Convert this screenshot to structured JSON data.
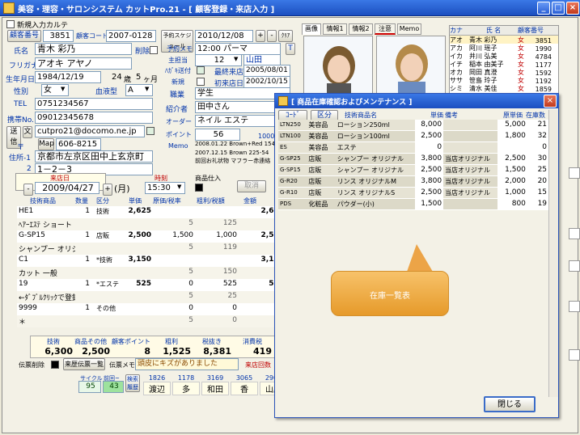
{
  "window": {
    "title": "美容・理容・サロンシステム カットPro.21 - [ 顧客登録・来店入力 ]"
  },
  "top": {
    "new_customer": "新規入力カルテ"
  },
  "customer": {
    "no_label": "顧客番号",
    "no": "3851",
    "code_label": "顧客コード",
    "code": "2007-0128",
    "delete_label": "削除",
    "name_label": "氏名",
    "name": "青木 彩乃",
    "kana_label": "フリガナ",
    "kana": "アオキ アヤノ",
    "birth_label": "生年月日",
    "birth": "1984/12/19",
    "age": "24",
    "age_unit": "歳",
    "month": "5",
    "month_unit": "ヶ月",
    "sex_label": "性別",
    "sex": "女",
    "blood_label": "血液型",
    "blood": "A",
    "tel_label": "TEL",
    "tel": "0751234567",
    "mobile_label": "携帯No.",
    "mobile": "09012345678",
    "mail_btn": "送信",
    "mail_sub": "文",
    "email": "cutpro21@docomo.ne.jp",
    "zip_label": "〒",
    "map_btn": "Map",
    "zip": "606-8215",
    "addr_label": "住所-1",
    "addr1": "京都市左京区田中上玄京町",
    "addr2": "1－2－3",
    "addr2_label": "2"
  },
  "reserve": {
    "btn": "予約スケジュール",
    "date": "2010/12/08",
    "memo_label": "予約メモ",
    "memo": "12:00 パーマ",
    "staff_label": "主担当",
    "staff_no": "12",
    "staff": "山田",
    "clear_btn": "ｸﾘｱ",
    "visit_label": "最終来店",
    "visit": "2005/08/01",
    "first_label": "初来店日",
    "first": "2002/10/15",
    "dm_label": "ﾊｶﾞｷ送付",
    "new_label": "新規",
    "job_label": "職業",
    "job": "学生",
    "intro_label": "紹介者",
    "intro": "田中さん",
    "order_label": "オーダー",
    "order": "ネイル エステ",
    "point_label": "ポイント",
    "point": "56",
    "point_yen": "1000 円",
    "memo2_label": "Memo",
    "memo2a": "2008.01.22 Brown+Red 154-",
    "memo2b": "2007.12.15 Brown 225-54",
    "memo2c": "前回お礼状物 マフラー赤連絡"
  },
  "tabs": [
    "画像",
    "情報1",
    "情報2",
    "注意",
    "Memo"
  ],
  "cust_list": {
    "tab": "カナ",
    "h_name": "氏 名",
    "h_no": "顧客番号",
    "rows": [
      [
        "アオ",
        "青木 彩乃",
        "女",
        "3851"
      ],
      [
        "アカ",
        "阿川 瑶子",
        "女",
        "1990"
      ],
      [
        "イカ",
        "井川 弘美",
        "女",
        "4784"
      ],
      [
        "イチ",
        "稲本 由美子",
        "女",
        "1177"
      ],
      [
        "オカ",
        "岡田 真澄",
        "女",
        "1592"
      ],
      [
        "ササ",
        "笹島 玲子",
        "女",
        "1192"
      ],
      [
        "シミ",
        "清水 美佳",
        "女",
        "1859"
      ]
    ]
  },
  "visit": {
    "date_label": "来店日",
    "date": "2009/04/27",
    "dow": "(月)",
    "time_label": "時刻",
    "time": "15:30",
    "goods_label": "商品仕入",
    "cancel_btn": "取消",
    "h_item": "技術商品",
    "h_qty": "数量",
    "h_cls": "区分",
    "h_price": "単価",
    "h_cost": "原価/税率",
    "h_profit": "粗利/税額",
    "h_amt": "金額",
    "rows": [
      {
        "code": "HE1",
        "qty": "1",
        "cls": "技術",
        "price": "2,625",
        "cost": "",
        "profit": "",
        "amt": "2,625"
      },
      {
        "code": "ﾍｱｰｴｽﾃ ショート",
        "qty": "",
        "cls": "",
        "price": "",
        "cost": "5",
        "profit": "125",
        "amt": ""
      },
      {
        "code": "G-SP15",
        "qty": "1",
        "cls": "店販",
        "price": "2,500",
        "cost": "1,500",
        "profit": "1,000",
        "amt": "2,500"
      },
      {
        "code": "シャンプー オリジナル",
        "qty": "",
        "cls": "",
        "price": "",
        "cost": "5",
        "profit": "119",
        "amt": ""
      },
      {
        "code": "C1",
        "qty": "1",
        "cls": "*技術",
        "price": "3,150",
        "cost": "",
        "profit": "",
        "amt": "3,150"
      },
      {
        "code": "カット 一般",
        "qty": "",
        "cls": "",
        "price": "",
        "cost": "5",
        "profit": "150",
        "amt": ""
      },
      {
        "code": "19",
        "qty": "1",
        "cls": "*エステ",
        "price": "525",
        "cost": "0",
        "profit": "525",
        "amt": "525"
      },
      {
        "code": "←ﾀﾞﾌﾞﾙｸﾘｯｸで登録",
        "qty": "",
        "cls": "",
        "price": "",
        "cost": "5",
        "profit": "25",
        "amt": ""
      },
      {
        "code": "9999",
        "qty": "1",
        "cls": "その他",
        "price": "",
        "cost": "0",
        "profit": "0",
        "amt": "0"
      },
      {
        "code": "＊",
        "qty": "",
        "cls": "",
        "price": "",
        "cost": "5",
        "profit": "0",
        "amt": ""
      }
    ]
  },
  "totals": {
    "h": [
      "技術",
      "商品その他",
      "顧客ポイント",
      "粗利",
      "税抜き",
      "消費税"
    ],
    "v": [
      "6,300",
      "2,500",
      "8",
      "1,525",
      "8,381",
      "419"
    ],
    "slip_del": "伝票削除",
    "slip_list": "来歴伝票一覧",
    "slip_memo_label": "伝票メモ",
    "slip_memo": "頭皮にキズがありました",
    "visit_count": "来店回数"
  },
  "history": {
    "cycle_label": "サイクル",
    "prev_label": "前回~",
    "cycle": "95",
    "prev": "43",
    "hist_btn": "検索履歴",
    "cols": [
      [
        "1826",
        "渡辺"
      ],
      [
        "1178",
        "多"
      ],
      [
        "3169",
        "和田"
      ],
      [
        "3065",
        "香"
      ],
      [
        "2909",
        "山脇"
      ]
    ]
  },
  "dialog": {
    "title": "[ 商品在庫確認およびメンテナンス ]",
    "btn_code": "ｺｰﾄﾞ",
    "btn_cls": "区分",
    "h": [
      "技術商品名",
      "単価",
      "備考",
      "原単価",
      "在庫数"
    ],
    "rows": [
      [
        "LTN250",
        "美容品",
        "ローション250ml",
        "8,000",
        "",
        "5,000",
        "21"
      ],
      [
        "LTN100",
        "美容品",
        "ローション100ml",
        "2,500",
        "",
        "1,800",
        "32"
      ],
      [
        "ES",
        "美容品",
        "エステ",
        "0",
        "",
        "",
        "0"
      ],
      [
        "G-SP25",
        "店販",
        "シャンプー オリジナル",
        "3,800",
        "当店オリジナル",
        "2,500",
        "30"
      ],
      [
        "G-SP15",
        "店販",
        "シャンプー オリジナル",
        "2,500",
        "当店オリジナル",
        "1,500",
        "25"
      ],
      [
        "G-R20",
        "店販",
        "リンス オリジナルM",
        "3,800",
        "当店オリジナル",
        "2,000",
        "20"
      ],
      [
        "G-R10",
        "店販",
        "リンス オリジナルS",
        "2,500",
        "当店オリジナル",
        "1,000",
        "15"
      ],
      [
        "PDS",
        "化粧品",
        "パウダー(小)",
        "1,500",
        "",
        "800",
        "19"
      ]
    ],
    "callout": "在庫一覧表",
    "close": "閉じる"
  }
}
